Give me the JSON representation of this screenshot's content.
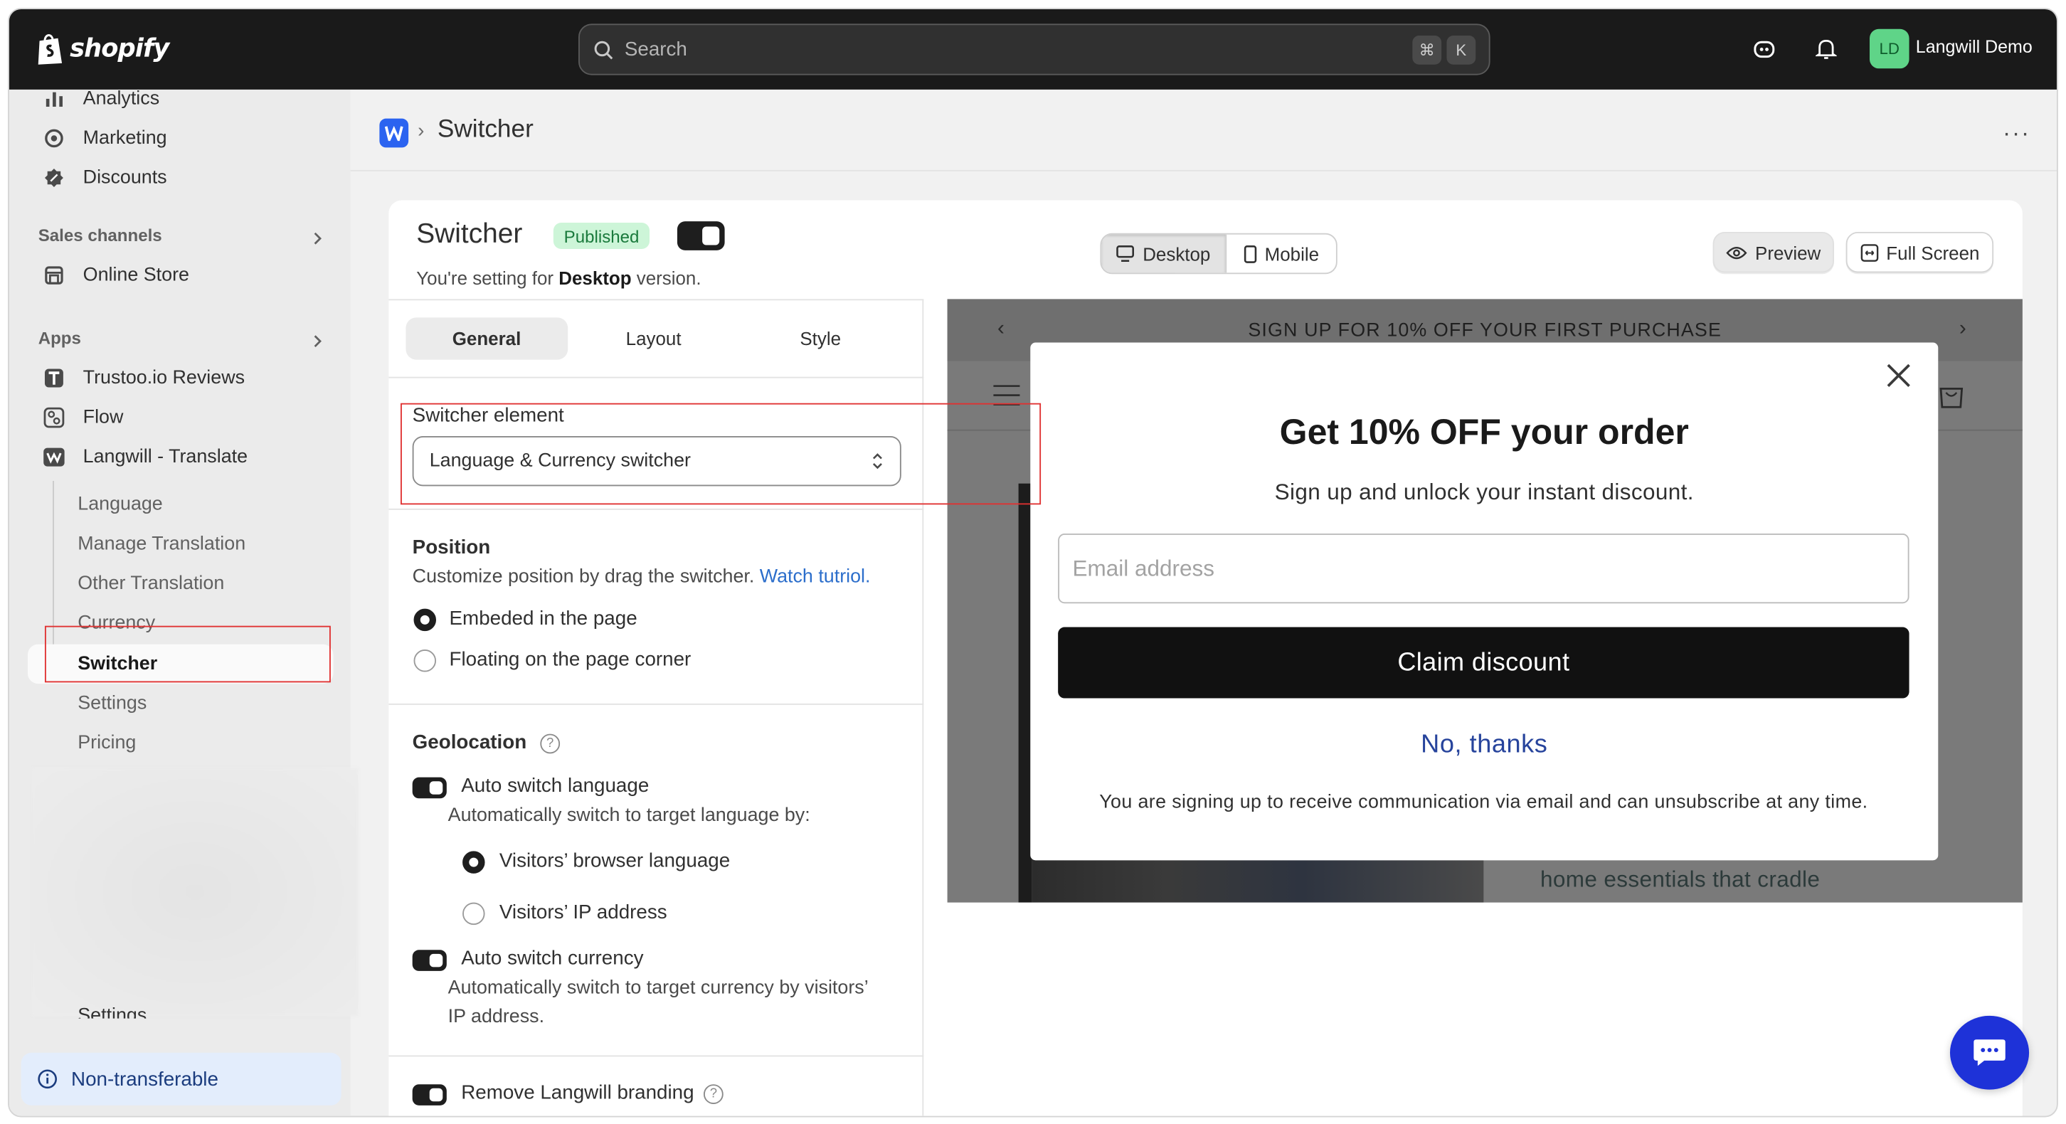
{
  "topbar": {
    "logo_text": "shopify",
    "search_placeholder": "Search",
    "shortcut_cmd": "⌘",
    "shortcut_key": "K",
    "avatar_initials": "LD",
    "store_name": "Langwill Demo"
  },
  "sidebar": {
    "items": [
      {
        "label": "Analytics",
        "icon": "bar-chart-icon"
      },
      {
        "label": "Marketing",
        "icon": "target-icon"
      },
      {
        "label": "Discounts",
        "icon": "discount-icon"
      }
    ],
    "sales_channels_title": "Sales channels",
    "online_store": "Online Store",
    "apps_title": "Apps",
    "apps": [
      {
        "label": "Trustoo.io Reviews",
        "icon": "trustoo-icon"
      },
      {
        "label": "Flow",
        "icon": "flow-icon"
      },
      {
        "label": "Langwill - Translate",
        "icon": "langwill-icon"
      }
    ],
    "sub_items": [
      "Language",
      "Manage Translation",
      "Other Translation",
      "Currency",
      "Switcher",
      "Settings",
      "Pricing"
    ],
    "hidden_item": "Settings",
    "non_transferable": "Non-transferable"
  },
  "header": {
    "title": "Switcher",
    "more": "···"
  },
  "card": {
    "title": "Switcher",
    "status_badge": "Published",
    "desc_prefix": "You're setting for ",
    "desc_bold": "Desktop",
    "desc_suffix": " version.",
    "device_tabs": [
      "Desktop",
      "Mobile"
    ],
    "preview_btn": "Preview",
    "fullscreen_btn": "Full Screen"
  },
  "settings": {
    "tabs": [
      "General",
      "Layout",
      "Style"
    ],
    "switcher_element_label": "Switcher element",
    "switcher_element_value": "Language & Currency switcher",
    "position_label": "Position",
    "position_desc": "Customize position by drag the switcher. ",
    "position_link": "Watch tutriol.",
    "position_options": [
      "Embeded in the page",
      "Floating on the page corner"
    ],
    "geolocation_label": "Geolocation",
    "auto_lang_label": "Auto switch language",
    "auto_lang_desc": "Automatically switch to target language by:",
    "lang_options": [
      "Visitors’ browser language",
      "Visitors’ IP address"
    ],
    "auto_currency_label": "Auto switch currency",
    "auto_currency_desc_1": "Automatically switch to target currency by visitors’",
    "auto_currency_desc_2": "IP address.",
    "branding_label": "Remove Langwill branding"
  },
  "preview": {
    "announcement": "SIGN UP FOR 10% OFF YOUR FIRST PURCHASE",
    "modal_title": "Get 10% OFF your order",
    "modal_sub": "Sign up and unlock your instant discount.",
    "email_placeholder": "Email address",
    "claim_btn": "Claim discount",
    "no_thanks": "No, thanks",
    "legal": "You are signing up to receive communication via email and can unsubscribe at any time.",
    "background_text": "home essentials that cradle"
  }
}
